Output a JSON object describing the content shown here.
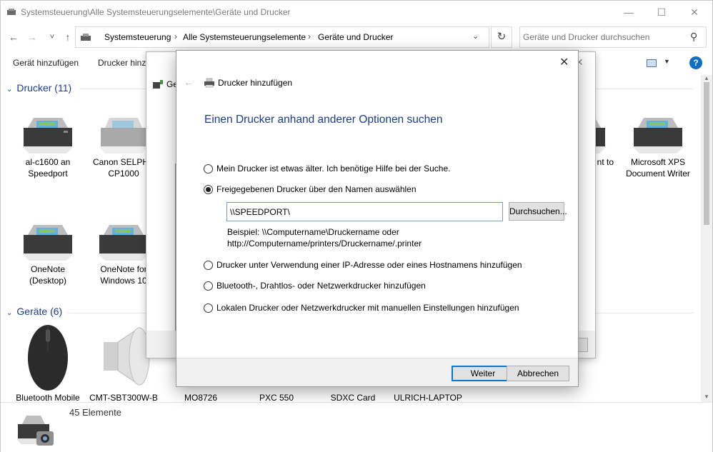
{
  "window": {
    "title": "Systemsteuerung\\Alle Systemsteuerungselemente\\Geräte und Drucker",
    "controls": {
      "minimize": "—",
      "maximize": "☐",
      "close": "✕"
    }
  },
  "nav": {
    "back": "←",
    "forward": "→",
    "recent": "˅",
    "up": "↑"
  },
  "breadcrumb": [
    "Systemsteuerung",
    "Alle Systemsteuerungselemente",
    "Geräte und Drucker"
  ],
  "search": {
    "placeholder": "Geräte und Drucker durchsuchen"
  },
  "toolbar": {
    "add_device": "Gerät hinzufügen",
    "add_printer": "Drucker hinzufügen"
  },
  "groups": {
    "printers": {
      "label": "Drucker (11)"
    },
    "devices": {
      "label": "Geräte (6)"
    }
  },
  "printers": [
    {
      "label": "al-c1600 an Speedport"
    },
    {
      "label": "Canon SELPHY CP1000"
    },
    {
      "label": "OneNote (Desktop)"
    },
    {
      "label": "OneNote for Windows 10"
    },
    {
      "label": "nt to"
    },
    {
      "label": "Microsoft XPS Document Writer"
    }
  ],
  "devices": [
    {
      "label": "Bluetooth Mobile"
    },
    {
      "label": "CMT-SBT300W-B"
    },
    {
      "label": "MO8726"
    },
    {
      "label": "PXC 550"
    },
    {
      "label": "SDXC Card"
    },
    {
      "label": "ULRICH-LAPTOP"
    }
  ],
  "status": {
    "count": "45 Elemente"
  },
  "background_wizard": {
    "title_fragment": "Ge"
  },
  "dialog": {
    "title": "Drucker hinzufügen",
    "heading": "Einen Drucker anhand anderer Optionen suchen",
    "options": [
      {
        "label": "Mein Drucker ist etwas älter. Ich benötige Hilfe bei der Suche.",
        "checked": false
      },
      {
        "label": "Freigegebenen Drucker über den Namen auswählen",
        "checked": true
      },
      {
        "label": "Drucker unter Verwendung einer IP-Adresse oder eines Hostnamens hinzufügen",
        "checked": false
      },
      {
        "label": "Bluetooth-, Drahtlos- oder Netzwerkdrucker hinzufügen",
        "checked": false
      },
      {
        "label": "Lokalen Drucker oder Netzwerkdrucker mit manuellen Einstellungen hinzufügen",
        "checked": false
      }
    ],
    "printer_name_value": "\\\\SPEEDPORT\\",
    "browse_label": "Durchsuchen...",
    "example_line1": "Beispiel: \\\\Computername\\Druckername oder",
    "example_line2": "http://Computername/printers/Druckername/.printer",
    "next_label": "Weiter",
    "cancel_label": "Abbrechen",
    "close_glyph": "✕",
    "back_glyph": "←"
  },
  "colors": {
    "heading": "#1a3c8c",
    "group_header": "#1e3d8f",
    "primary_border": "#0078d7"
  }
}
